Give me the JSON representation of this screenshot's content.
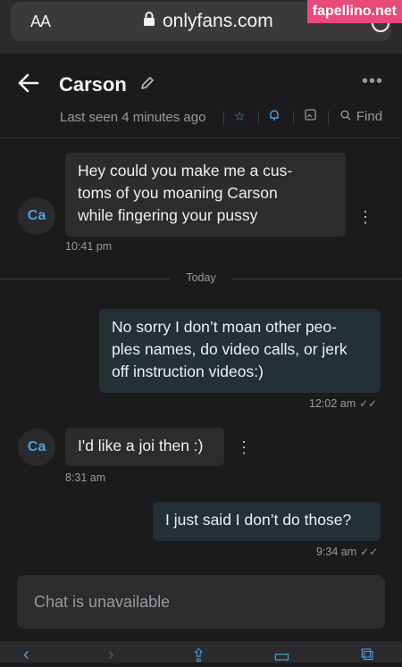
{
  "browser": {
    "aa_label": "AA",
    "url": "onlyfans.com",
    "watermark": "fapellino.net"
  },
  "header": {
    "title": "Carson",
    "last_seen": "Last seen 4 minutes ago",
    "find_label": "Find"
  },
  "messages": [
    {
      "side": "in",
      "avatar": "Ca",
      "lines": [
        "Hey could you make me a cus-",
        "toms of you moaning Carson",
        "while fingering your pussy"
      ],
      "time": "10:41 pm"
    },
    {
      "side": "out",
      "lines": [
        "No sorry I don’t moan other peo-",
        "ples names, do video calls, or jerk",
        "off instruction videos:)"
      ],
      "time": "12:02 am"
    },
    {
      "side": "in",
      "avatar": "Ca",
      "lines": [
        "I'd like a joi then :)"
      ],
      "time": "8:31 am"
    },
    {
      "side": "out",
      "lines": [
        "I just said I don’t do those?"
      ],
      "time": "9:34 am"
    }
  ],
  "divider": {
    "label": "Today"
  },
  "composer": {
    "placeholder": "Chat is unavailable"
  },
  "colors": {
    "accent": "#4aa3e0",
    "background": "#1b1b1d",
    "bubble_in": "#2c2c2f",
    "bubble_out": "#233036"
  }
}
